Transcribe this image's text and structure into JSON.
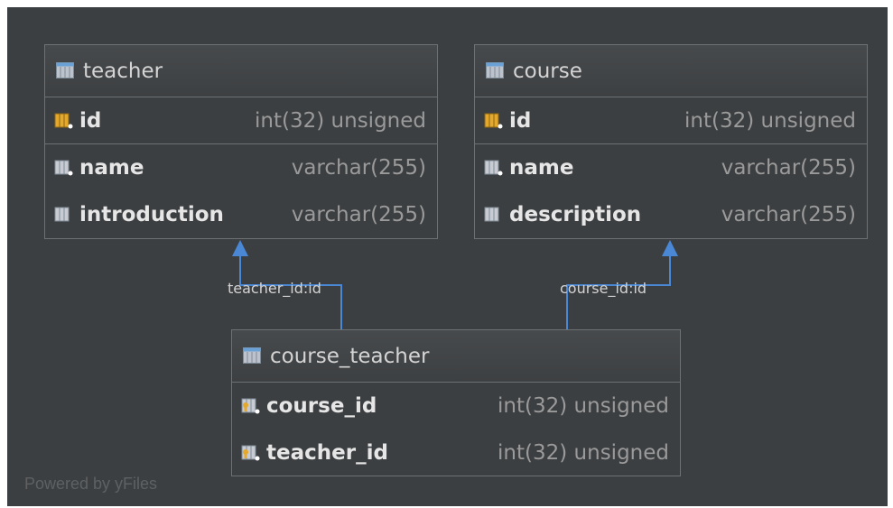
{
  "tables": {
    "teacher": {
      "title": "teacher",
      "columns": [
        {
          "name": "id",
          "type": "int(32) unsigned",
          "icon": "primary-key-icon"
        },
        {
          "name": "name",
          "type": "varchar(255)",
          "icon": "column-icon"
        },
        {
          "name": "introduction",
          "type": "varchar(255)",
          "icon": "column-icon"
        }
      ]
    },
    "course": {
      "title": "course",
      "columns": [
        {
          "name": "id",
          "type": "int(32) unsigned",
          "icon": "primary-key-icon"
        },
        {
          "name": "name",
          "type": "varchar(255)",
          "icon": "column-icon"
        },
        {
          "name": "description",
          "type": "varchar(255)",
          "icon": "column-icon"
        }
      ]
    },
    "course_teacher": {
      "title": "course_teacher",
      "columns": [
        {
          "name": "course_id",
          "type": "int(32) unsigned",
          "icon": "foreign-key-icon"
        },
        {
          "name": "teacher_id",
          "type": "int(32) unsigned",
          "icon": "foreign-key-icon"
        }
      ]
    }
  },
  "relations": [
    {
      "label": "teacher_id:id"
    },
    {
      "label": "course_id:id"
    }
  ],
  "watermark": "Powered by yFiles",
  "colors": {
    "background": "#3c3f41",
    "edge": "#4a88d6",
    "table_border": "#6e7173",
    "key_icon": "#e3a82c"
  }
}
